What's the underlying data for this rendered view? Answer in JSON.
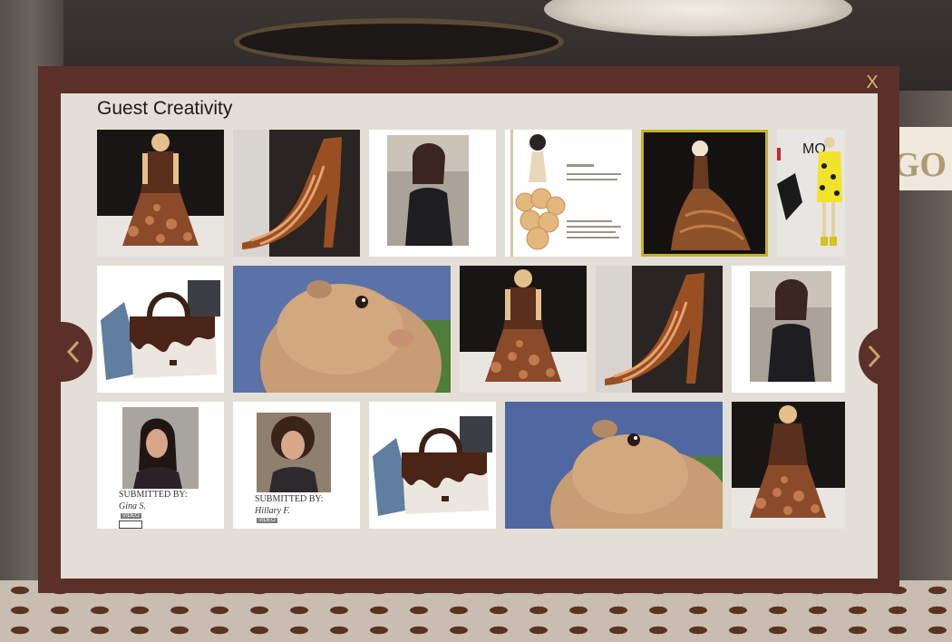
{
  "modal": {
    "title": "Guest Creativity",
    "close_label": "X"
  },
  "navigation": {
    "prev_icon": "chevron-left-icon",
    "next_icon": "chevron-right-icon",
    "arrow_color": "#c8a46a"
  },
  "background": {
    "sign_text": "GO"
  },
  "gallery": {
    "selected_color": "#c4b22e",
    "items": [
      {
        "type": "photo",
        "subject": "chocolate-dress-runway"
      },
      {
        "type": "photo",
        "subject": "chocolate-high-heel"
      },
      {
        "type": "video",
        "subject": "woman-speaking-kitchen"
      },
      {
        "type": "photo",
        "subject": "chocolate-dress-sketch"
      },
      {
        "type": "photo",
        "subject": "chocolate-gown-dark",
        "selected": true
      },
      {
        "type": "photo",
        "subject": "moschino-runway-yellow"
      },
      {
        "type": "photo",
        "subject": "chocolate-handbag"
      },
      {
        "type": "gif",
        "subject": "dramatic-chipmunk"
      },
      {
        "type": "photo",
        "subject": "chocolate-dress-runway"
      },
      {
        "type": "photo",
        "subject": "chocolate-high-heel"
      },
      {
        "type": "video",
        "subject": "woman-speaking-kitchen"
      },
      {
        "type": "video",
        "subject": "woman-portrait",
        "submitted_label": "SUBMITTED BY:",
        "submitter": "Gina S.",
        "badge": "VIDEO"
      },
      {
        "type": "video",
        "subject": "woman-portrait-curly",
        "submitted_label": "SUBMITTED BY:",
        "submitter": "Hillary F.",
        "badge": "VIDEO"
      },
      {
        "type": "photo",
        "subject": "chocolate-handbag"
      },
      {
        "type": "gif",
        "subject": "dramatic-chipmunk"
      },
      {
        "type": "photo",
        "subject": "chocolate-dress-runway"
      }
    ]
  }
}
